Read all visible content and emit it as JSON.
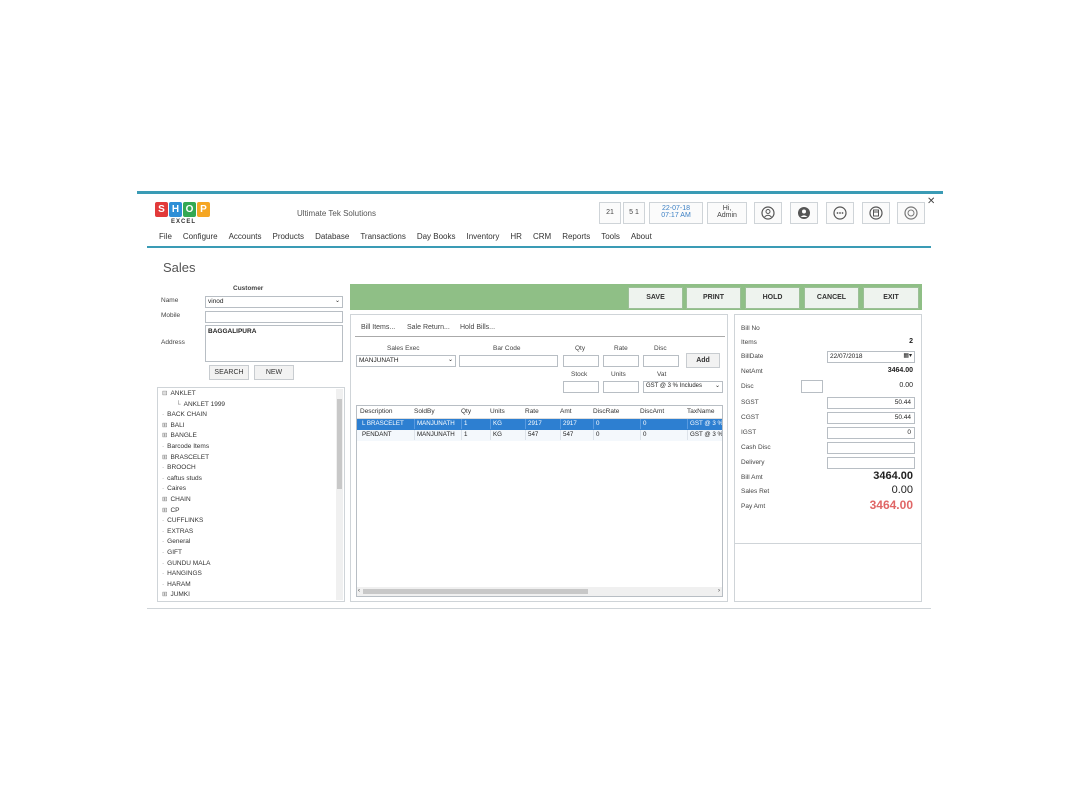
{
  "app": {
    "logo_letters": [
      "S",
      "H",
      "O",
      "P"
    ],
    "logo_colors": [
      "#e23a3a",
      "#2f8fd6",
      "#34a853",
      "#f5a623"
    ],
    "logo_sub": "EXCEL",
    "company": "Ultimate Tek Solutions"
  },
  "topbar": {
    "counter_a": "21",
    "counter_b": "5 1",
    "date": "22-07-18",
    "time": "07:17 AM",
    "greeting": "Hi,",
    "user": "Admin",
    "icons": [
      "user-circle-icon",
      "person-icon",
      "more-icon",
      "calculator-icon",
      "power-icon"
    ]
  },
  "menu": [
    "File",
    "Configure",
    "Accounts",
    "Products",
    "Database",
    "Transactions",
    "Day Books",
    "Inventory",
    "HR",
    "CRM",
    "Reports",
    "Tools",
    "About"
  ],
  "page_title": "Sales",
  "customer": {
    "header": "Customer",
    "name_label": "Name",
    "name_value": "vinod",
    "mobile_label": "Mobile",
    "mobile_value": "",
    "address_label": "Address",
    "address_value": "BAGGALIPURA",
    "search_label": "SEARCH",
    "new_label": "NEW"
  },
  "tree": [
    {
      "text": "ANKLET",
      "prefix": "⊟",
      "indent": 0
    },
    {
      "text": "ANKLET 1999",
      "prefix": "└",
      "indent": 1
    },
    {
      "text": "BACK CHAIN",
      "prefix": "·",
      "indent": 0
    },
    {
      "text": "BALI",
      "prefix": "⊞",
      "indent": 0
    },
    {
      "text": "BANGLE",
      "prefix": "⊞",
      "indent": 0
    },
    {
      "text": "Barcode Items",
      "prefix": "·",
      "indent": 0
    },
    {
      "text": "BRASCELET",
      "prefix": "⊞",
      "indent": 0
    },
    {
      "text": "BROOCH",
      "prefix": "·",
      "indent": 0
    },
    {
      "text": "caftus studs",
      "prefix": "·",
      "indent": 0
    },
    {
      "text": "Caires",
      "prefix": "·",
      "indent": 0
    },
    {
      "text": "CHAIN",
      "prefix": "⊞",
      "indent": 0
    },
    {
      "text": "CP",
      "prefix": "⊞",
      "indent": 0
    },
    {
      "text": "CUFFLINKS",
      "prefix": "·",
      "indent": 0
    },
    {
      "text": "EXTRAS",
      "prefix": "·",
      "indent": 0
    },
    {
      "text": "General",
      "prefix": "·",
      "indent": 0
    },
    {
      "text": "GIFT",
      "prefix": "·",
      "indent": 0
    },
    {
      "text": "GUNDU MALA",
      "prefix": "·",
      "indent": 0
    },
    {
      "text": "HANGINGS",
      "prefix": "·",
      "indent": 0
    },
    {
      "text": "HARAM",
      "prefix": "·",
      "indent": 0
    },
    {
      "text": "JUMKI",
      "prefix": "⊞",
      "indent": 0
    }
  ],
  "actions": [
    "SAVE",
    "PRINT",
    "HOLD",
    "CANCEL",
    "EXIT"
  ],
  "tabs": [
    "Bill Items...",
    "Sale Return...",
    "Hold Bills..."
  ],
  "entry": {
    "sales_exec_label": "Sales Exec",
    "sales_exec_value": "MANJUNATH",
    "barcode_label": "Bar Code",
    "qty_label": "Qty",
    "rate_label": "Rate",
    "disc_label": "Disc",
    "add_label": "Add",
    "stock_label": "Stock",
    "units_label": "Units",
    "vat_label": "Vat",
    "vat_value": "GST @ 3 % Includes"
  },
  "grid": {
    "columns": [
      "Description",
      "SoldBy",
      "Qty",
      "Units",
      "Rate",
      "Amt",
      "DiscRate",
      "DiscAmt",
      "TaxName"
    ],
    "rows": [
      [
        "L BRASCELET",
        "MANJUNATH",
        "1",
        "KG",
        "2917",
        "2917",
        "0",
        "0",
        "GST @ 3 %"
      ],
      [
        "PENDANT",
        "MANJUNATH",
        "1",
        "KG",
        "547",
        "547",
        "0",
        "0",
        "GST @ 3 %"
      ]
    ]
  },
  "summary": {
    "bill_no_label": "Bill No",
    "bill_no_value": "",
    "items_label": "Items",
    "items_value": "2",
    "billdate_label": "BillDate",
    "billdate_value": "22/07/2018",
    "netamt_label": "NetAmt",
    "netamt_value": "3464.00",
    "disc_label": "Disc",
    "disc_value": "0.00",
    "sgst_label": "SGST",
    "sgst_value": "50.44",
    "cgst_label": "CGST",
    "cgst_value": "50.44",
    "igst_label": "IGST",
    "igst_value": "0",
    "cashdisc_label": "Cash Disc",
    "delivery_label": "Delivery",
    "billamt_label": "Bill Amt",
    "billamt_value": "3464.00",
    "salesret_label": "Sales Ret",
    "salesret_value": "0.00",
    "payamt_label": "Pay Amt",
    "payamt_value": "3464.00",
    "payamt_color": "#e06666"
  },
  "colors": {
    "accent": "#3a9bb5",
    "action_bar": "#8fbf86",
    "selected_row": "#2d7fd1"
  }
}
